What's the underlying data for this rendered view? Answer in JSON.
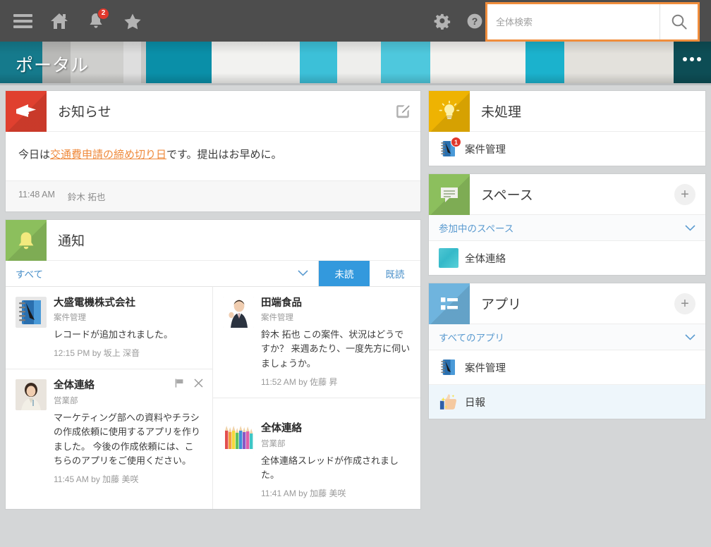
{
  "topbar": {
    "menu_icon": "hamburger-icon",
    "home_icon": "home-icon",
    "bell_icon": "bell-icon",
    "bell_badge": "2",
    "star_icon": "star-icon",
    "gear_icon": "gear-icon",
    "help_icon": "help-icon",
    "search": {
      "placeholder": "全体検索",
      "value": "",
      "button_icon": "search-icon",
      "focus_color": "#f08d3c"
    }
  },
  "banner": {
    "title": "ポータル",
    "more_icon": "more-options-icon"
  },
  "announcement": {
    "title": "お知らせ",
    "icon": "megaphone-icon",
    "icon_color": "#e0402f",
    "edit_icon": "edit-pencil-icon",
    "body_prefix": "今日は",
    "body_link": "交通費申請の締め切り日",
    "body_suffix": "です。提出はお早めに。",
    "link_color": "#ef8a3c",
    "time": "11:48 AM",
    "author": "鈴木 拓也"
  },
  "notifications": {
    "title": "通知",
    "icon": "bell-icon",
    "icon_color": "#8cbf5d",
    "filter_label": "すべて",
    "filter_chevron": "chevron-down-icon",
    "tabs": [
      {
        "label": "未読",
        "active": true
      },
      {
        "label": "既読",
        "active": false
      }
    ],
    "active_tab_color": "#3399dd",
    "left_items": [
      {
        "title": "大盛電機株式会社",
        "app": "案件管理",
        "text": "レコードが追加されました。",
        "time": "12:15 PM",
        "by": "by 坂上 深音",
        "avatar": "notebook-app-icon",
        "has_actions": false
      },
      {
        "title": "全体連絡",
        "app": "営業部",
        "text": "マーケティング部への資料やチラシの作成依頼に使用するアプリを作りました。 今後の作成依頼には、こちらのアプリをご使用ください。",
        "time": "11:45 AM",
        "by": "by 加藤 美咲",
        "avatar": "user-photo-female",
        "has_actions": true,
        "flag_icon": "flag-icon",
        "close_icon": "close-icon"
      }
    ],
    "right_items": [
      {
        "title": "田端食品",
        "app": "案件管理",
        "text": "鈴木 拓也 この案件、状況はどうですか？ 来週あたり、一度先方に伺いましょうか。",
        "time": "11:52 AM",
        "by": "by 佐藤 昇",
        "avatar": "user-photo-male",
        "has_actions": false
      },
      {
        "title": "全体連絡",
        "app": "営業部",
        "text": "全体連絡スレッドが作成されました。",
        "time": "11:41 AM",
        "by": "by 加藤 美咲",
        "avatar": "pencils-icon",
        "has_actions": false
      }
    ]
  },
  "unprocessed": {
    "title": "未処理",
    "icon": "lightbulb-icon",
    "icon_color": "#eeb302",
    "items": [
      {
        "label": "案件管理",
        "badge": "1",
        "icon": "notebook-app-icon"
      }
    ]
  },
  "spaces": {
    "title": "スペース",
    "icon": "chat-bubble-icon",
    "icon_color": "#8cbf5d",
    "add_icon": "plus-icon",
    "subhead": "参加中のスペース",
    "subhead_chevron": "chevron-down-icon",
    "items": [
      {
        "label": "全体連絡",
        "icon": "space-thumbnail"
      }
    ]
  },
  "apps": {
    "title": "アプリ",
    "icon": "app-list-icon",
    "icon_color": "#6fb4de",
    "add_icon": "plus-icon",
    "subhead": "すべてのアプリ",
    "subhead_chevron": "chevron-down-icon",
    "items": [
      {
        "label": "案件管理",
        "icon": "notebook-app-icon",
        "highlight": false
      },
      {
        "label": "日報",
        "icon": "thumbs-up-icon",
        "highlight": true
      }
    ]
  }
}
